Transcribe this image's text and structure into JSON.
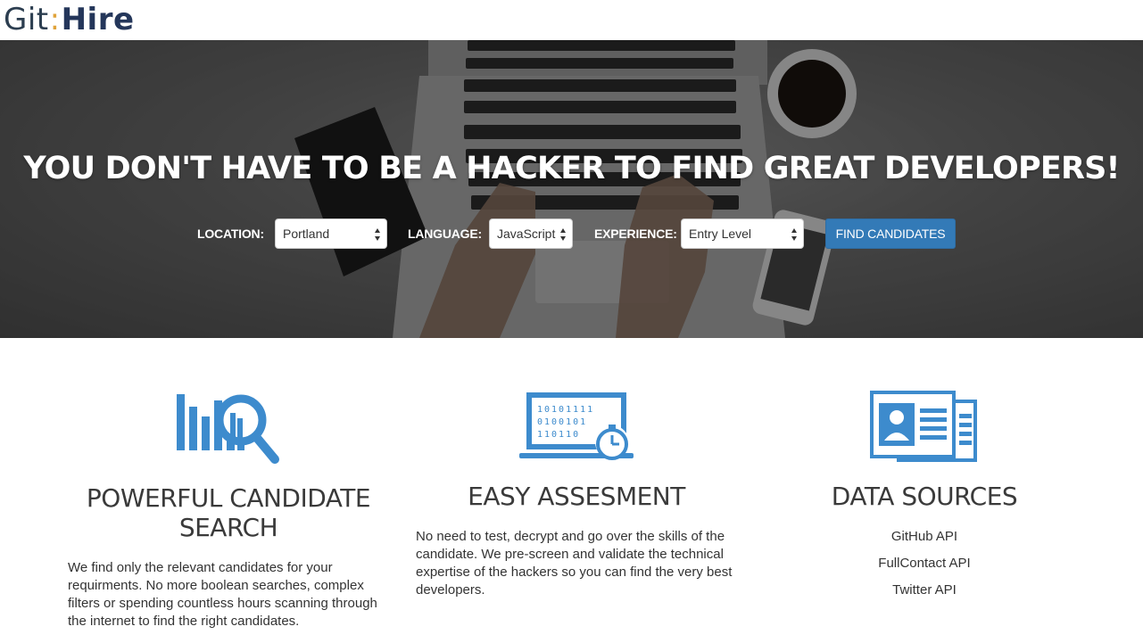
{
  "app": {
    "logo_part1": "Git",
    "logo_sep": ":",
    "logo_part2": "Hire"
  },
  "hero": {
    "title": "YOU DON'T HAVE TO BE A HACKER TO FIND GREAT DEVELOPERS!",
    "filters": {
      "location_label": "LOCATION:",
      "location_value": "Portland",
      "language_label": "LANGUAGE:",
      "language_value": "JavaScript",
      "experience_label": "EXPERIENCE:",
      "experience_value": "Entry Level",
      "submit_label": "FIND CANDIDATES"
    }
  },
  "features": [
    {
      "icon": "search-chart-icon",
      "title": "POWERFUL CANDIDATE SEARCH",
      "text": "We find only the relevant candidates for your requirments. No more boolean searches, complex filters or spending countless hours scanning through the internet to find the right candidates."
    },
    {
      "icon": "laptop-binary-stopwatch-icon",
      "title": "EASY ASSESMENT",
      "text": "No need to test, decrypt and go over the skills of the candidate. We pre-screen and validate the technical expertise of the hackers so you can find the very best developers."
    },
    {
      "icon": "profile-cards-icon",
      "title": "DATA SOURCES",
      "items": [
        "GitHub API",
        "FullContact API",
        "Twitter API"
      ]
    }
  ],
  "binary_lines": [
    "10101111",
    "0100101",
    "110110"
  ],
  "colors": {
    "accent": "#3d8bcd",
    "button": "#337ab7",
    "logo_dark": "#24365a",
    "logo_sep": "#e0a33a"
  }
}
